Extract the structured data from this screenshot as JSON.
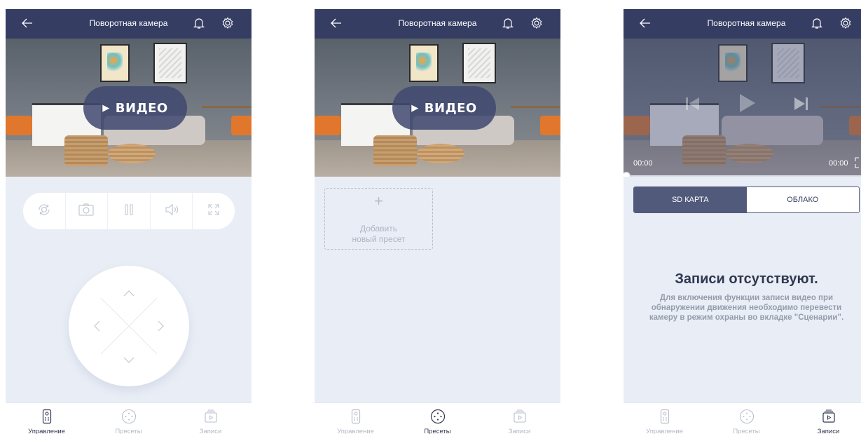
{
  "title": "Поворотная камера",
  "video_button": "ВИДЕО",
  "tabs": {
    "control": "Управление",
    "presets": "Пресеты",
    "records": "Записи"
  },
  "presets": {
    "add_line1": "Добавить",
    "add_line2": "новый пресет",
    "plus": "+"
  },
  "records": {
    "time_start": "00:00",
    "time_end": "00:00",
    "progress": 0,
    "segment_sd": "SD КАРТА",
    "segment_cloud": "ОБЛАКО",
    "empty_title": "Записи отсутствуют.",
    "empty_desc": "Для включения функции записи видео при обнаружении движения необходимо перевести камеру в режим охраны во вкладке \"Сценарии\"."
  },
  "colors": {
    "header_bg": "#353d63",
    "screen_bg": "#e9eef6",
    "accent": "#515a7b"
  },
  "icons": {
    "back": "arrow-left-icon",
    "bell": "bell-icon",
    "gear": "gear-icon",
    "play": "play-icon",
    "rotate": "rotate-camera-icon",
    "snapshot": "camera-icon",
    "pause": "pause-icon",
    "sound": "speaker-icon",
    "fullscreen": "expand-icon",
    "remote": "remote-icon",
    "presets": "presets-dots-icon",
    "records": "records-icon"
  }
}
